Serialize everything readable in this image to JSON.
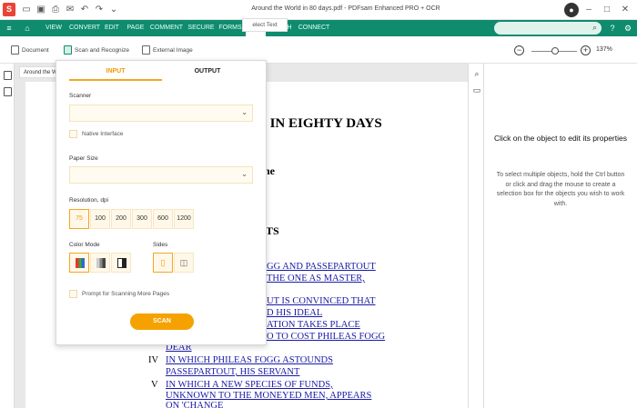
{
  "window": {
    "title": "Around the World in 80 days.pdf - PDFsam Enhanced PRO + OCR",
    "logo_letter": "S"
  },
  "menu": {
    "items": [
      "HOME",
      "VIEW",
      "CONVERT",
      "EDIT",
      "PAGE",
      "COMMENT",
      "SECURE",
      "FORMS",
      "OCR",
      "BATCH",
      "CONNECT"
    ],
    "active": "OCR"
  },
  "ribbon": {
    "document_label": "Document",
    "scan_label": "Scan and Recognize",
    "external_label": "External Image",
    "zoom_value": "137%"
  },
  "doc": {
    "tab_label": "Around the World",
    "select_text_label": "elect Text",
    "heading1": "D IN EIGHTY DAYS",
    "heading2": "ne",
    "heading3": "TS",
    "lines": [
      "GG AND PASSEPARTOUT",
      "THE ONE AS MASTER,",
      "UT IS CONVINCED THAT",
      "D HIS IDEAL",
      "ATION TAKES PLACE",
      "O TO COST PHILEAS FOGG",
      "DEAR",
      "IN WHICH PHILEAS FOGG ASTOUNDS",
      "PASSEPARTOUT, HIS SERVANT",
      "IN WHICH A NEW SPECIES OF FUNDS,",
      "UNKNOWN TO THE MONEYED MEN, APPEARS",
      "ON 'CHANGE"
    ],
    "num4": "IV",
    "num5": "V"
  },
  "scan_panel": {
    "tab_input": "INPUT",
    "tab_output": "OUTPUT",
    "scanner_label": "Scanner",
    "native_interface_label": "Native Interface",
    "paper_size_label": "Paper Size",
    "resolution_label": "Resolution, dpi",
    "resolutions": [
      "75",
      "100",
      "200",
      "300",
      "600",
      "1200"
    ],
    "selected_resolution": "75",
    "color_mode_label": "Color Mode",
    "sides_label": "Sides",
    "prompt_label": "Prompt for Scanning More Pages",
    "scan_button": "SCAN"
  },
  "properties": {
    "title": "Click on the object to edit its properties",
    "body": "To select multiple objects, hold the Ctrl button or click and drag the mouse to create a selection box for the objects you wish to work with."
  },
  "colors": {
    "menubar": "#0f8b6e",
    "accent": "#f5a200"
  }
}
